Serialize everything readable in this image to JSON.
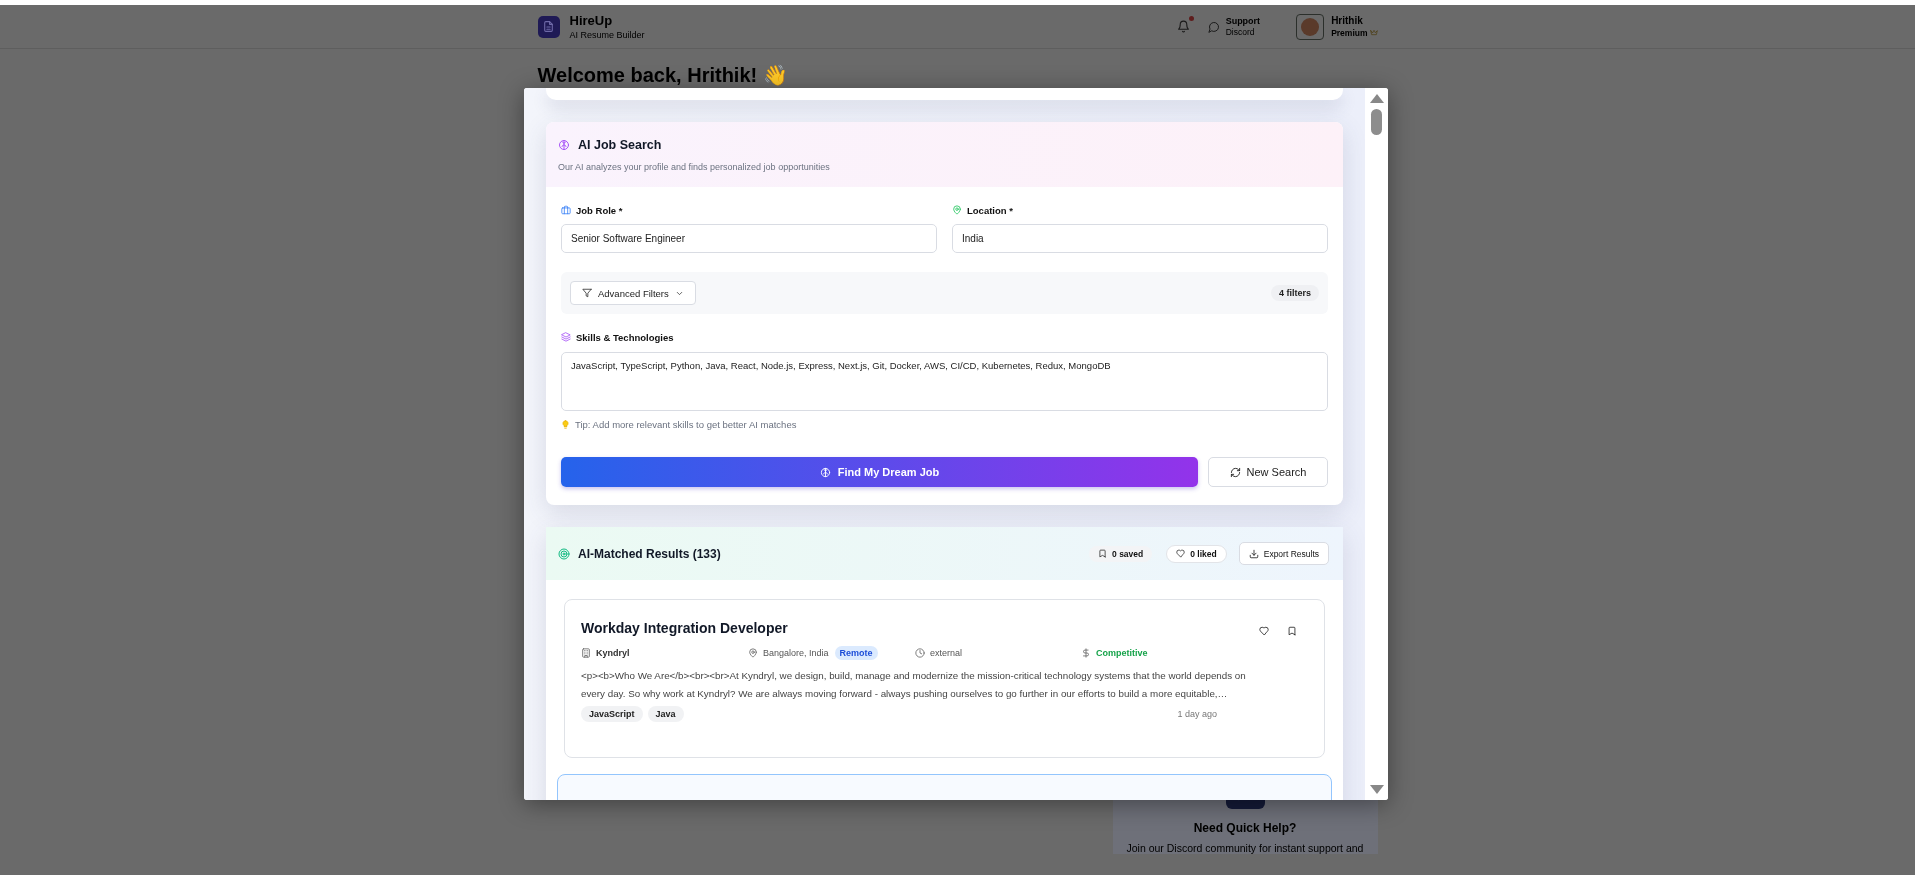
{
  "header": {
    "app_name": "HireUp",
    "tagline": "AI Resume Builder",
    "notification_unread": true,
    "support": {
      "label": "Support",
      "sublabel": "Discord"
    },
    "user": {
      "name": "Hrithik",
      "plan": "Premium"
    }
  },
  "welcome": "Welcome back, Hrithik! 👋",
  "quick_help": {
    "title": "Need Quick Help?",
    "text": "Join our Discord community for instant support and"
  },
  "job_search": {
    "title": "AI Job Search",
    "subtitle": "Our AI analyzes your profile and finds personalized job opportunities",
    "fields": [
      {
        "kind": "role",
        "label": "Job Role *",
        "value": "Senior Software Engineer"
      },
      {
        "kind": "location",
        "label": "Location *",
        "value": "India"
      }
    ],
    "advanced_filters": {
      "label": "Advanced Filters",
      "expanded": false,
      "count": "4 filters"
    },
    "skills": {
      "label": "Skills & Technologies",
      "value": "JavaScript, TypeScript, Python, Java, React, Node.js, Express, Next.js, Git, Docker, AWS, CI/CD, Kubernetes, Redux, MongoDB"
    },
    "tip": "Tip: Add more relevant skills to get better AI matches",
    "primary_button": "Find My Dream Job",
    "secondary_button": "New Search"
  },
  "results": {
    "title": "AI-Matched Results (133)",
    "saved": "0 saved",
    "liked": "0 liked",
    "export": "Export Results",
    "jobs": [
      {
        "title": "Workday Integration Developer",
        "company": "Kyndryl",
        "location": "Bangalore, India",
        "work_mode": "Remote",
        "source": "external",
        "salary": "Competitive",
        "description": "<p><b>Who We Are</b><br><br>At Kyndryl, we design, build, manage and modernize the mission-critical technology systems that the world depends on every day. So why work at Kyndryl? We are always moving forward - always pushing ourselves to go further in our efforts to build a more equitable,…",
        "tags": [
          "JavaScript",
          "Java"
        ],
        "posted": "1 day ago",
        "liked": false,
        "saved": false
      }
    ]
  }
}
